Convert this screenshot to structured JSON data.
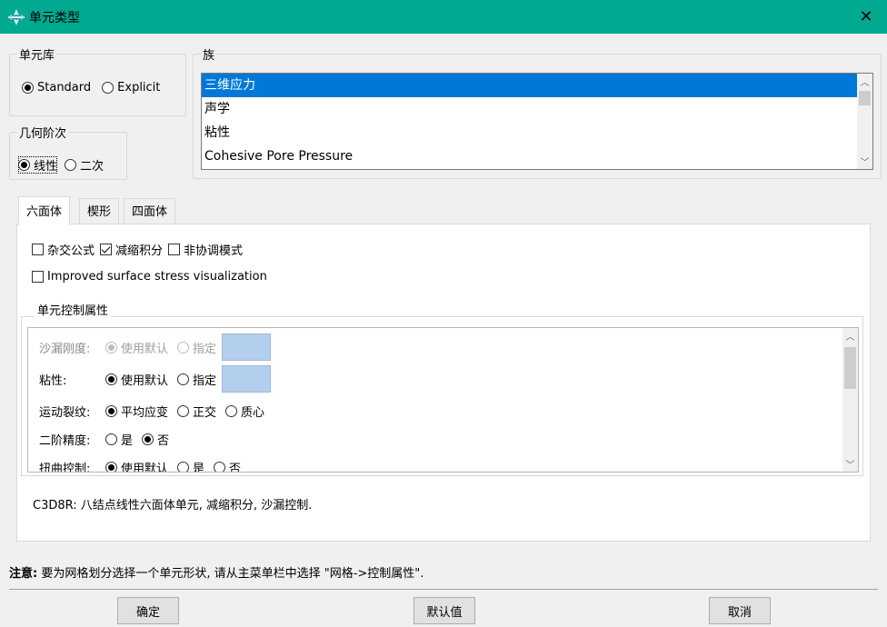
{
  "window": {
    "title": "单元类型",
    "close_label": "✕",
    "accent": "#00a98f"
  },
  "element_library": {
    "legend": "单元库",
    "options": [
      "Standard",
      "Explicit"
    ],
    "selected": "Standard"
  },
  "geometric_order": {
    "legend": "几何阶次",
    "options": [
      "线性",
      "二次"
    ],
    "selected": "线性"
  },
  "family": {
    "legend": "族",
    "items": [
      "三维应力",
      "声学",
      "粘性",
      "Cohesive Pore Pressure"
    ],
    "selected": "三维应力"
  },
  "tabs": [
    {
      "label": "六面体",
      "active": true
    },
    {
      "label": "楔形",
      "active": false
    },
    {
      "label": "四面体",
      "active": false
    }
  ],
  "options": {
    "hybrid": {
      "label": "杂交公式",
      "checked": false
    },
    "reduced": {
      "label": "减缩积分",
      "checked": true
    },
    "incompatible": {
      "label": "非协调模式",
      "checked": false
    },
    "improved_stress": {
      "label": "Improved surface stress visualization",
      "checked": false
    }
  },
  "element_controls": {
    "legend": "单元控制属性",
    "rows": [
      {
        "label": "沙漏刚度:",
        "options": [
          "使用默认",
          "指定"
        ],
        "selected": "使用默认",
        "disabled": true,
        "has_value_box": true
      },
      {
        "label": "粘性:",
        "options": [
          "使用默认",
          "指定"
        ],
        "selected": "使用默认",
        "disabled": false,
        "has_value_box": true
      },
      {
        "label": "运动裂纹:",
        "options": [
          "平均应变",
          "正交",
          "质心"
        ],
        "selected": "平均应变",
        "disabled": false,
        "has_value_box": false
      },
      {
        "label": "二阶精度:",
        "options": [
          "是",
          "否"
        ],
        "selected": "否",
        "disabled": false,
        "has_value_box": false
      },
      {
        "label": "扭曲控制:",
        "options": [
          "使用默认",
          "是",
          "否"
        ],
        "selected": "使用默认",
        "disabled": false,
        "has_value_box": false
      }
    ]
  },
  "description": "C3D8R:  八结点线性六面体单元, 减缩积分, 沙漏控制.",
  "note": {
    "prefix": "注意:",
    "text": " 要为网格划分选择一个单元形状, 请从主菜单栏中选择 \"网格->控制属性\"."
  },
  "buttons": {
    "ok": "确定",
    "defaults": "默认值",
    "cancel": "取消"
  }
}
